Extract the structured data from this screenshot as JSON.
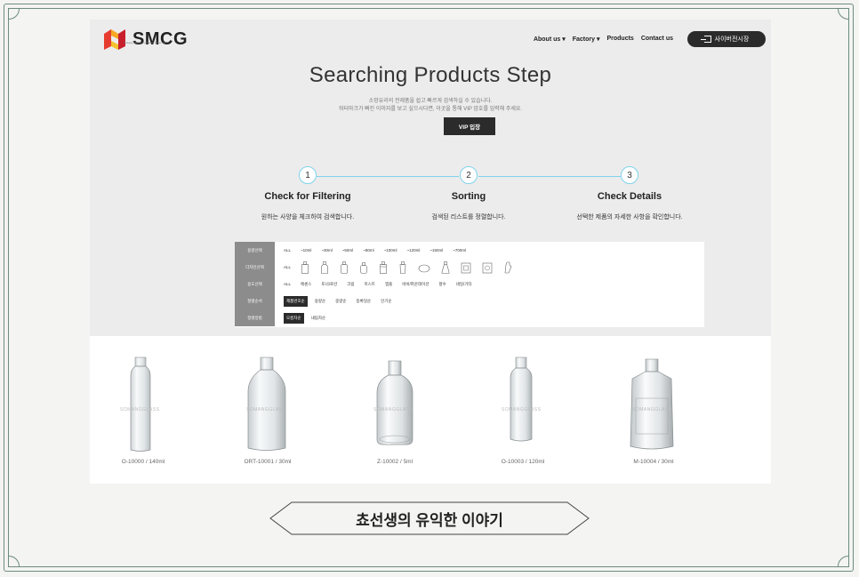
{
  "brand": {
    "name": "SMCG",
    "sub": "Sobang Myeon Container Glass Co."
  },
  "nav": {
    "about": "About us ▾",
    "factory": "Factory ▾",
    "products": "Products",
    "contact": "Contact us",
    "login": "사이버전시장"
  },
  "hero": {
    "title": "Searching Products Step",
    "desc1": "소망유리의 전제품을 쉽고 빠르게 검색하실 수 있습니다.",
    "desc2": "워터마크가 빠진 이미지를 보고 싶으시다면, 이곳을 통해 VIP 암호를 입력해 주세요.",
    "vip": "VIP 입장"
  },
  "steps": [
    {
      "num": "1",
      "title": "Check for Filtering",
      "desc": "원하는 사양을 체크하여 검색합니다."
    },
    {
      "num": "2",
      "title": "Sorting",
      "desc": "검색된 리스트를 정렬합니다."
    },
    {
      "num": "3",
      "title": "Check Details",
      "desc": "선택한 제품의 자세한 사항을 확인합니다."
    }
  ],
  "filters": {
    "capacity": {
      "label": "용량선택",
      "options": [
        "ALL",
        "~10ml",
        "~30ml",
        "~50ml",
        "~80ml",
        "~100ml",
        "~120ml",
        "~150ml",
        "~700ml"
      ]
    },
    "design": {
      "label": "디자인선택",
      "all": "ALL"
    },
    "usage": {
      "label": "용도선택",
      "options": [
        "ALL",
        "에센스",
        "토너/로션",
        "크림",
        "미스트",
        "앰플",
        "비비/파운데이션",
        "향수",
        "네일/기타"
      ]
    },
    "sort": {
      "label": "정렬순서",
      "options": [
        "제품번호순",
        "용량순",
        "중량순",
        "등록일순",
        "인기순"
      ]
    },
    "method": {
      "label": "정렬방법",
      "options": [
        "오름차순",
        "내림차순"
      ]
    }
  },
  "products": [
    {
      "label": "O-10000 / 140ml",
      "watermark": "SOMANGGLASS"
    },
    {
      "label": "ORT-10001 / 30ml",
      "watermark": "SOMANGGLASS"
    },
    {
      "label": "Z-10002 / 5ml",
      "watermark": "SOMANGGLASS"
    },
    {
      "label": "O-10003 / 120ml",
      "watermark": "SOMANGGLASS"
    },
    {
      "label": "M-10004 / 30ml",
      "watermark": "SOMANGGLASS"
    }
  ],
  "banner": {
    "text": "쵸선생의 유익한 이야기"
  }
}
